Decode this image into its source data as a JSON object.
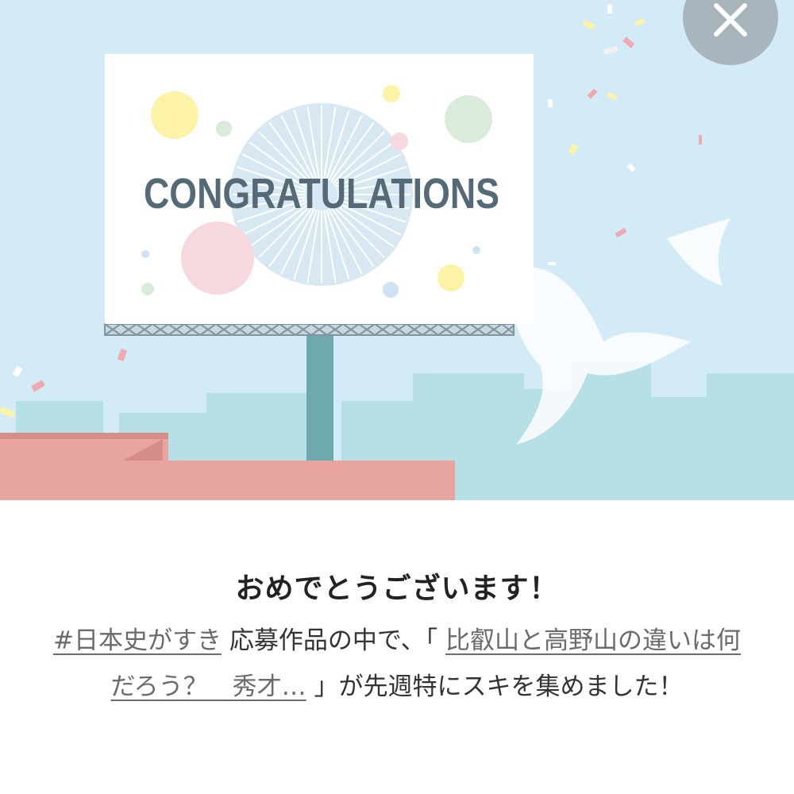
{
  "banner": {
    "billboard_text": "CONGRATULATIONS"
  },
  "close_button": {
    "icon": "close-icon",
    "color": "#a9b5bd"
  },
  "message": {
    "title": "おめでとうございます！",
    "hashtag": "#日本史がすき",
    "text1": "応募作品の中で、「",
    "article_title": "比叡山と高野山の違いは何だろう？　秀才…",
    "text2": "」が先週特にスキを集めました！"
  },
  "colors": {
    "sky": "#d3ebf7",
    "billboard_text": "#556a77",
    "rooftop": "#e8a59f"
  }
}
